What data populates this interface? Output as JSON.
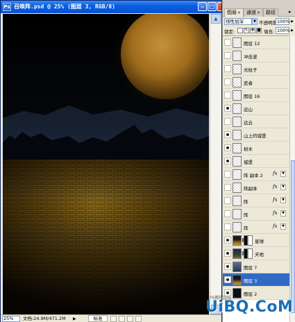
{
  "document": {
    "title": "召唤阵.psd @ 25% (图层 3, RGB/8)",
    "icon": "Ps",
    "status": {
      "zoom": "25%",
      "doc_size": "文档:24.9M/471.2M",
      "mode_label": "标准"
    }
  },
  "colors": {
    "titlebar": "#0a5ee0",
    "selection": "#316ac5",
    "moon": "#a9741e",
    "ground": "#6d5313"
  },
  "layers_panel": {
    "tabs": [
      {
        "label": "图层",
        "icon": "close-x"
      },
      {
        "label": "通道",
        "icon": "close-x"
      },
      {
        "label": "路径",
        "icon": ""
      }
    ],
    "blend_mode": "线性加深",
    "opacity_label": "不透明度:",
    "opacity_value": "100%",
    "lock_label": "锁定:",
    "fill_label": "填充:",
    "fill_value": "100%",
    "layers": [
      {
        "name": "图层 12",
        "visible": false,
        "thumb": "checker",
        "fx": false,
        "mask": false,
        "selected": false
      },
      {
        "name": "冲击波",
        "visible": false,
        "thumb": "checker",
        "fx": false,
        "mask": false,
        "selected": false
      },
      {
        "name": "光柱子",
        "visible": false,
        "thumb": "checker",
        "fx": false,
        "mask": false,
        "selected": false
      },
      {
        "name": "武者",
        "visible": false,
        "thumb": "checker",
        "fx": false,
        "mask": false,
        "selected": false
      },
      {
        "name": "图层 16",
        "visible": false,
        "thumb": "checker",
        "fx": false,
        "mask": false,
        "selected": false
      },
      {
        "name": "远山",
        "visible": true,
        "thumb": "checker",
        "fx": false,
        "mask": false,
        "selected": false
      },
      {
        "name": "远云",
        "visible": false,
        "thumb": "checker",
        "fx": false,
        "mask": false,
        "selected": false
      },
      {
        "name": "山上的城堡",
        "visible": true,
        "thumb": "checker",
        "fx": false,
        "mask": false,
        "selected": false
      },
      {
        "name": "树木",
        "visible": true,
        "thumb": "checker",
        "fx": false,
        "mask": false,
        "selected": false
      },
      {
        "name": "城堡",
        "visible": true,
        "thumb": "checker",
        "fx": false,
        "mask": false,
        "selected": false
      },
      {
        "name": "阵 副本 2",
        "visible": false,
        "thumb": "checker",
        "fx": true,
        "mask": false,
        "selected": false
      },
      {
        "name": "阵副本",
        "visible": false,
        "thumb": "checker",
        "fx": true,
        "mask": false,
        "selected": false
      },
      {
        "name": "阵",
        "visible": false,
        "thumb": "checker",
        "fx": true,
        "mask": false,
        "selected": false
      },
      {
        "name": "阵",
        "visible": false,
        "thumb": "checker",
        "fx": true,
        "mask": false,
        "selected": false
      },
      {
        "name": "阵",
        "visible": false,
        "thumb": "checker",
        "fx": true,
        "mask": false,
        "selected": false
      },
      {
        "name": "星球",
        "visible": true,
        "thumb": "gold",
        "fx": false,
        "mask": true,
        "selected": false
      },
      {
        "name": "天地",
        "visible": true,
        "thumb": "scene",
        "fx": false,
        "mask": true,
        "selected": false
      },
      {
        "name": "图层 7",
        "visible": true,
        "thumb": "blue",
        "fx": false,
        "mask": false,
        "selected": false
      },
      {
        "name": "图层 3",
        "visible": true,
        "thumb": "gold",
        "fx": false,
        "mask": false,
        "selected": true
      },
      {
        "name": "图层 2",
        "visible": true,
        "thumb": "dark",
        "fx": false,
        "mask": false,
        "selected": false
      }
    ]
  },
  "watermark": {
    "text": "UiBQ.CoM",
    "sub": "PS教程论坛"
  }
}
